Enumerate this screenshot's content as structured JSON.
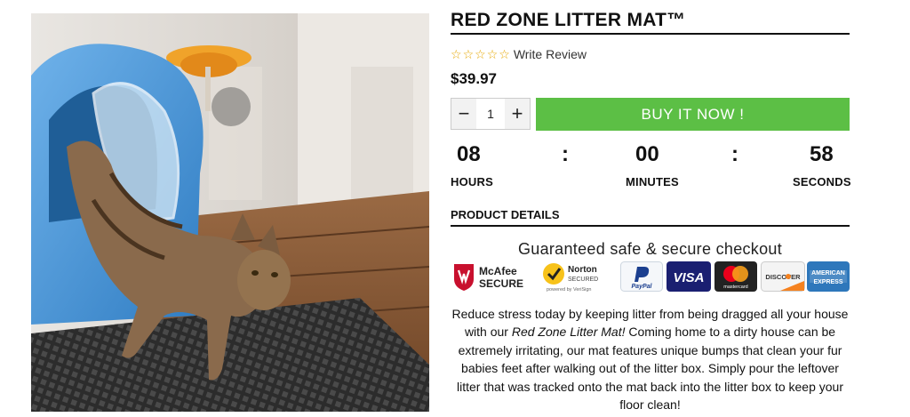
{
  "product": {
    "title": "RED ZONE LITTER MAT™",
    "rating_stars": 0,
    "rating_max": 5,
    "write_review": "Write Review",
    "price": "$39.97",
    "quantity": "1",
    "qty_minus": "−",
    "qty_plus": "+",
    "buy_button": "BUY IT NOW !"
  },
  "countdown": {
    "hours": "08",
    "minutes": "00",
    "seconds": "58",
    "separator": ":",
    "hours_label": "HOURS",
    "minutes_label": "MINUTES",
    "seconds_label": "SECONDS"
  },
  "details": {
    "heading": "PRODUCT DETAILS",
    "secure_heading": "Guaranteed safe & secure checkout",
    "badges": {
      "mcafee_line1": "McAfee",
      "mcafee_line2": "SECURE",
      "norton_line1": "Norton",
      "norton_line2": "SECURED",
      "norton_line3": "powered by VeriSign",
      "paypal": "PayPal",
      "visa": "VISA",
      "mastercard": "mastercard",
      "discover": "DISCOVER",
      "amex_line1": "AMERICAN",
      "amex_line2": "EXPRESS"
    },
    "description_part1": "Reduce stress today by keeping litter from being dragged all your house with our ",
    "description_italic": "Red Zone Litter Mat!",
    "description_part2": " Coming home to a dirty house can be extremely irritating, our mat features unique bumps that clean your fur babies feet after walking out of the litter box. Simply pour the leftover litter that was tracked onto the mat back into the litter box to keep your floor clean!"
  },
  "colors": {
    "buy_green": "#5cbf45",
    "star_gold": "#e6a700",
    "litter_box_blue": "#3e8fd2",
    "mcafee_red": "#c8102e",
    "visa_blue": "#1a1f71",
    "amex_blue": "#2e77bb"
  }
}
